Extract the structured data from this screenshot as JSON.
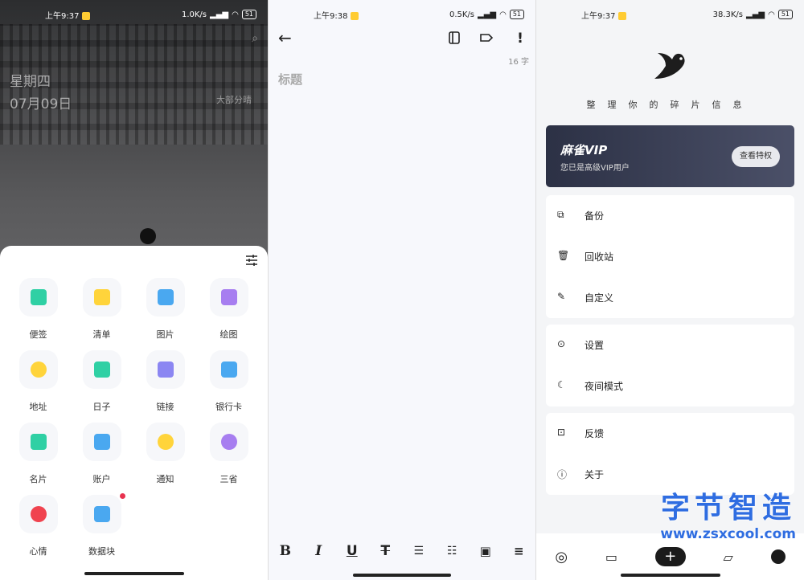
{
  "panel1": {
    "status": {
      "time": "上午9:37",
      "speed": "1.0K/s",
      "battery": "51"
    },
    "day_name": "星期四",
    "date": "07月09日",
    "weather": "大部分晴",
    "items": [
      {
        "label": "便签",
        "icon": "note-icon",
        "color": "#2fd0a4"
      },
      {
        "label": "清单",
        "icon": "checklist-icon",
        "color": "#ffd43b"
      },
      {
        "label": "图片",
        "icon": "image-icon",
        "color": "#4aa8f0"
      },
      {
        "label": "绘图",
        "icon": "pencil-icon",
        "color": "#a77ef0"
      },
      {
        "label": "地址",
        "icon": "location-icon",
        "color": "#ffd43b"
      },
      {
        "label": "日子",
        "icon": "calendar-icon",
        "color": "#2fd0a4"
      },
      {
        "label": "链接",
        "icon": "link-icon",
        "color": "#8b86f2"
      },
      {
        "label": "银行卡",
        "icon": "bank-card-icon",
        "color": "#4aa8f0"
      },
      {
        "label": "名片",
        "icon": "business-card-icon",
        "color": "#2fd0a4"
      },
      {
        "label": "账户",
        "icon": "account-icon",
        "color": "#4aa8f0"
      },
      {
        "label": "通知",
        "icon": "bell-icon",
        "color": "#ffd43b"
      },
      {
        "label": "三省",
        "icon": "question-icon",
        "color": "#a77ef0"
      },
      {
        "label": "心情",
        "icon": "heart-icon",
        "color": "#f0434f"
      },
      {
        "label": "数据块",
        "icon": "bar-chart-icon",
        "color": "#4aa8f0"
      }
    ]
  },
  "panel2": {
    "status": {
      "time": "上午9:38",
      "speed": "0.5K/s",
      "battery": "51"
    },
    "char_count": "16 字",
    "title_placeholder": "标题",
    "format_tools": [
      "B",
      "I",
      "U",
      "S",
      "ol",
      "ul",
      "img",
      "align"
    ]
  },
  "panel3": {
    "status": {
      "time": "上午9:37",
      "speed": "38.3K/s",
      "battery": "51"
    },
    "slogan": "整理你的碎片信息",
    "vip": {
      "title": "麻雀VIP",
      "subtitle": "您已是高级VIP用户",
      "button": "查看特权"
    },
    "menu_group1": [
      {
        "label": "备份",
        "icon": "backup-icon"
      },
      {
        "label": "回收站",
        "icon": "trash-icon"
      },
      {
        "label": "自定义",
        "icon": "pencil-icon"
      }
    ],
    "menu_group2": [
      {
        "label": "设置",
        "icon": "settings-icon"
      },
      {
        "label": "夜间模式",
        "icon": "moon-icon"
      }
    ],
    "menu_group3": [
      {
        "label": "反馈",
        "icon": "inbox-icon"
      },
      {
        "label": "关于",
        "icon": "info-icon"
      }
    ],
    "watermark": {
      "title": "字节智造",
      "url": "www.zsxcool.com"
    }
  }
}
